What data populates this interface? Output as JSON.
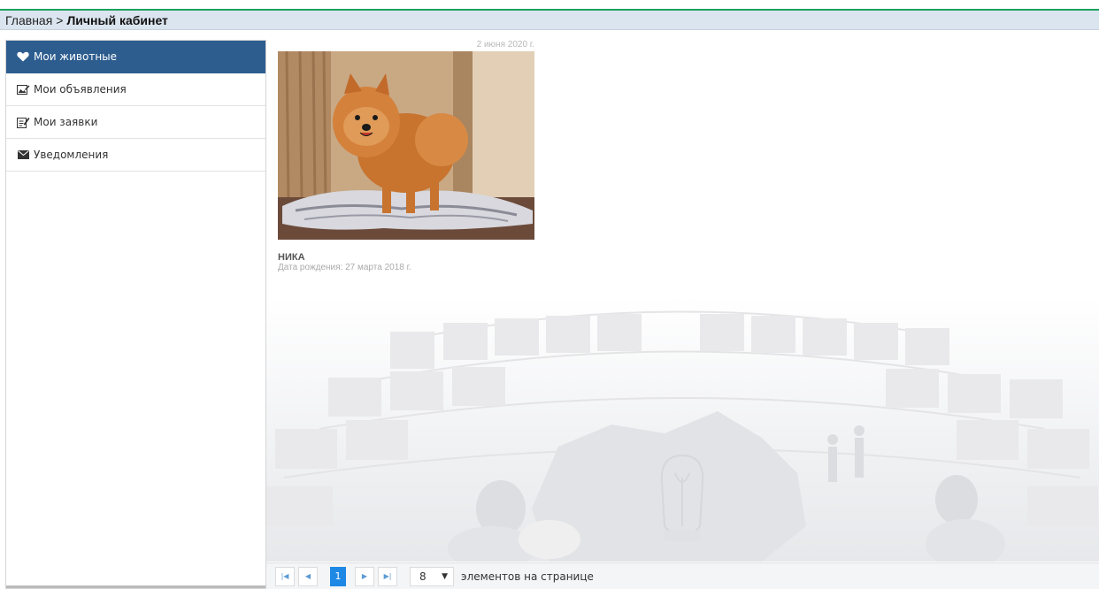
{
  "breadcrumb": {
    "home": "Главная",
    "separator": ">",
    "current": "Личный кабинет"
  },
  "sidebar": {
    "items": [
      {
        "label": "Мои животные",
        "icon": "heart-icon",
        "active": true
      },
      {
        "label": "Мои объявления",
        "icon": "image-edit-icon",
        "active": false
      },
      {
        "label": "Мои заявки",
        "icon": "edit-note-icon",
        "active": false
      },
      {
        "label": "Уведомления",
        "icon": "envelope-icon",
        "active": false
      }
    ]
  },
  "card": {
    "date": "2 июня 2020 г.",
    "name": "НИКА",
    "birth": "Дата рождения: 27 марта 2018 г."
  },
  "pager": {
    "first_icon": "first-page-icon",
    "prev_icon": "prev-page-icon",
    "current_page": "1",
    "next_icon": "next-page-icon",
    "last_icon": "last-page-icon",
    "page_size": "8",
    "page_size_label": "элементов на странице"
  },
  "colors": {
    "accent": "#2d5d8f",
    "pager_active": "#1e88e5",
    "top_line": "#1aa260"
  }
}
